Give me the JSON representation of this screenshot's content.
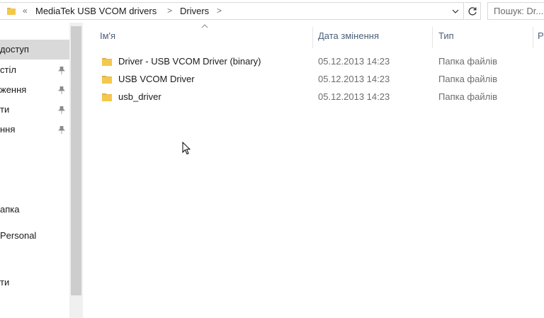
{
  "address_bar": {
    "overflow_chevron": "«",
    "segments": [
      "MediaTek USB VCOM drivers",
      "Drivers"
    ],
    "separator": ">"
  },
  "search": {
    "placeholder": "Пошук: Dr..."
  },
  "nav_pane": {
    "items": [
      {
        "label": "доступ",
        "selected": true,
        "pinned": false
      },
      {
        "label": "стіл",
        "pinned": true
      },
      {
        "label": "ження",
        "pinned": true
      },
      {
        "label": "ти",
        "pinned": true
      },
      {
        "label": "ння",
        "pinned": true
      },
      {
        "label": "",
        "pinned": false
      },
      {
        "label": "",
        "pinned": false
      },
      {
        "label": "апка",
        "pinned": false
      },
      {
        "label": "Personal",
        "pinned": false
      },
      {
        "label": "",
        "pinned": false
      },
      {
        "label": "ти",
        "pinned": false
      }
    ]
  },
  "columns": {
    "name": "Ім'я",
    "date": "Дата змінення",
    "type": "Тип",
    "size": "Р"
  },
  "files": [
    {
      "name": "Driver - USB VCOM Driver (binary)",
      "date": "05.12.2013 14:23",
      "type": "Папка файлів"
    },
    {
      "name": "USB VCOM Driver",
      "date": "05.12.2013 14:23",
      "type": "Папка файлів"
    },
    {
      "name": "usb_driver",
      "date": "05.12.2013 14:23",
      "type": "Папка файлів"
    }
  ],
  "colors": {
    "folder": "#f4c84c",
    "folder_dark": "#dca83a",
    "header_text": "#4c607a",
    "selected_bg": "#d9d9d9"
  },
  "icons": [
    "folder-icon",
    "chevron-right-icon",
    "chevron-down-icon",
    "refresh-icon",
    "pin-icon",
    "sort-up-icon",
    "mouse-cursor-icon"
  ]
}
